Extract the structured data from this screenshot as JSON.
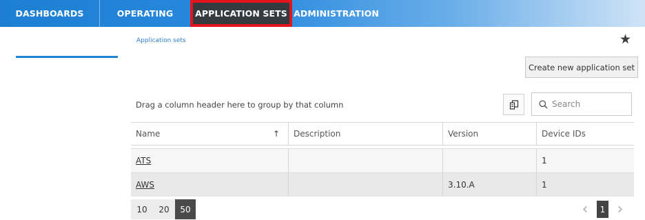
{
  "nav": {
    "items": [
      {
        "label": "DASHBOARDS"
      },
      {
        "label": "OPERATING"
      },
      {
        "label": "APPLICATION SETS"
      },
      {
        "label": "ADMINISTRATION"
      }
    ],
    "active": "APPLICATION SETS",
    "colors": {
      "active_bg": "#333a40",
      "highlight_border": "#e4141c",
      "bar": "#1c7fd1"
    }
  },
  "breadcrumb": "Application sets",
  "favorite_icon": "star-icon",
  "create_button": "Create new application set",
  "group_hint": "Drag a column header here to group by that column",
  "column_menu_icon": "column-chooser-icon",
  "search": {
    "placeholder": "Search",
    "value": "",
    "icon": "search-icon"
  },
  "table": {
    "columns": [
      "Name",
      "Description",
      "Version",
      "Device IDs"
    ],
    "sort": {
      "column": "Name",
      "direction": "ascending"
    },
    "rows": [
      {
        "name": "ATS",
        "description": "",
        "version": "",
        "device_ids": "1"
      },
      {
        "name": "AWS",
        "description": "",
        "version": "3.10.A",
        "device_ids": "1"
      }
    ]
  },
  "pager": {
    "page_sizes": [
      "10",
      "20",
      "50"
    ],
    "selected_page_size": "50",
    "prev": "‹",
    "next": "›",
    "current_page": "1"
  }
}
